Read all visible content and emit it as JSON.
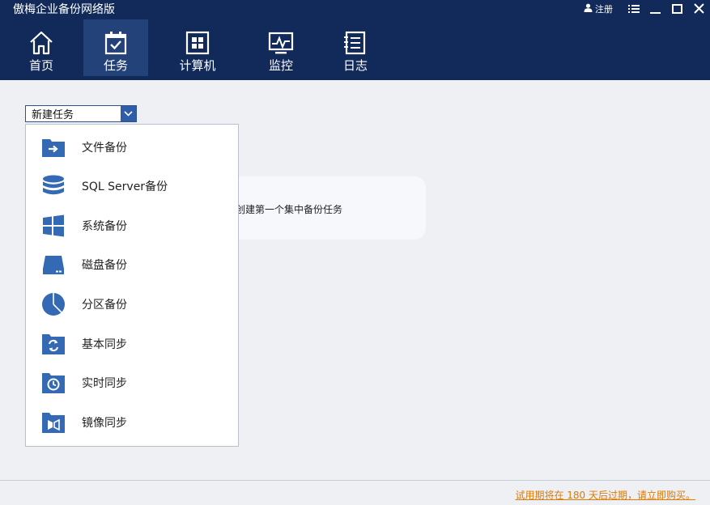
{
  "app": {
    "title": "傲梅企业备份网络版",
    "register_label": "注册"
  },
  "nav": {
    "items": [
      {
        "label": "首页",
        "icon": "home-icon"
      },
      {
        "label": "任务",
        "icon": "task-icon",
        "active": true
      },
      {
        "label": "计算机",
        "icon": "computer-icon"
      },
      {
        "label": "监控",
        "icon": "monitor-icon"
      },
      {
        "label": "日志",
        "icon": "log-icon"
      }
    ]
  },
  "toolbar": {
    "new_task_label": "新建任务"
  },
  "menu": {
    "items": [
      {
        "label": "文件备份",
        "icon": "file-backup-icon"
      },
      {
        "label": "SQL Server备份",
        "icon": "database-icon"
      },
      {
        "label": "系统备份",
        "icon": "windows-icon"
      },
      {
        "label": "磁盘备份",
        "icon": "disk-icon"
      },
      {
        "label": "分区备份",
        "icon": "partition-icon"
      },
      {
        "label": "基本同步",
        "icon": "sync-icon"
      },
      {
        "label": "实时同步",
        "icon": "clock-sync-icon"
      },
      {
        "label": "镜像同步",
        "icon": "mirror-sync-icon"
      }
    ]
  },
  "hint": {
    "text": "创建第一个集中备份任务"
  },
  "footer": {
    "trial_text": "试用期将在 180 天后过期，请立即购买。"
  },
  "colors": {
    "header_bg": "#112a5a",
    "nav_active_bg": "#24427a",
    "accent_blue": "#3469b4",
    "trial_link": "#e07a00"
  }
}
